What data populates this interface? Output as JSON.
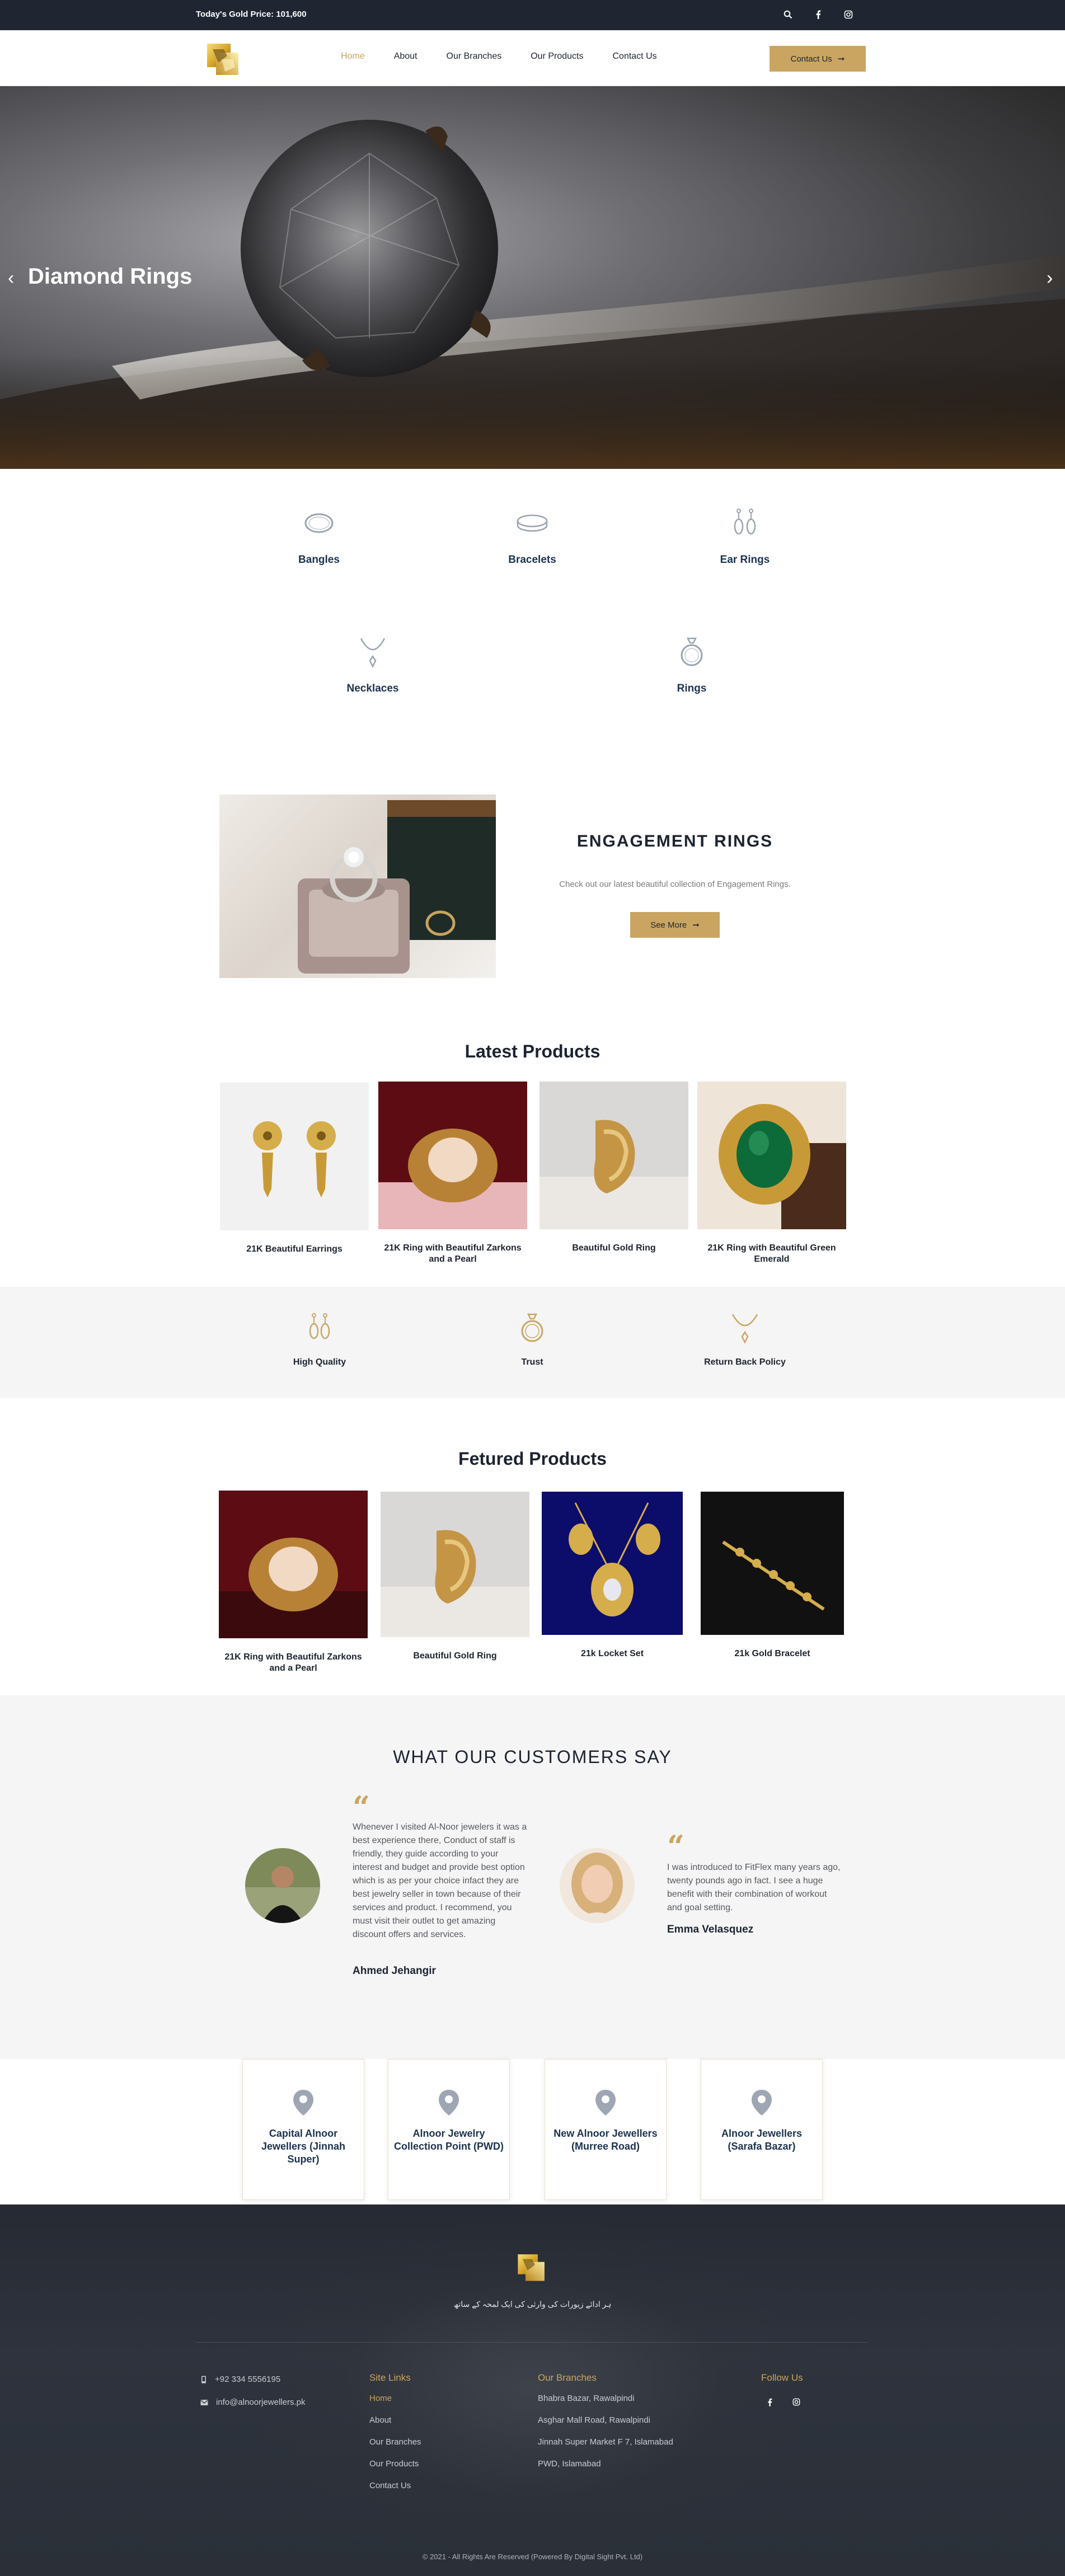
{
  "topbar": {
    "gold_price": "Today's Gold Price: 101,600",
    "icons": [
      "search-icon",
      "facebook-icon",
      "instagram-icon"
    ]
  },
  "nav": {
    "items": [
      {
        "label": "Home",
        "active": true
      },
      {
        "label": "About"
      },
      {
        "label": "Our Branches"
      },
      {
        "label": "Our Products"
      },
      {
        "label": "Contact Us"
      }
    ],
    "cta": "Contact Us"
  },
  "hero": {
    "title": "Diamond Rings",
    "prev_arrow": "‹",
    "next_arrow": "›"
  },
  "categories": [
    {
      "label": "Bangles",
      "icon": "bangle-icon"
    },
    {
      "label": "Bracelets",
      "icon": "bracelet-icon"
    },
    {
      "label": "Ear Rings",
      "icon": "earrings-icon"
    },
    {
      "label": "Necklaces",
      "icon": "necklace-icon"
    },
    {
      "label": "Rings",
      "icon": "ring-icon"
    }
  ],
  "engagement": {
    "title": "ENGAGEMENT RINGS",
    "subtitle": "Check out our latest beautiful collection of Engagement Rings.",
    "button": "See More"
  },
  "latest": {
    "heading": "Latest Products",
    "products": [
      {
        "name": "21K Beautiful Earrings"
      },
      {
        "name": "21K Ring with Beautiful Zarkons and a Pearl"
      },
      {
        "name": "Beautiful Gold Ring"
      },
      {
        "name": "21K Ring with Beautiful Green Emerald"
      }
    ]
  },
  "features": [
    {
      "label": "High Quality",
      "icon": "earrings-icon"
    },
    {
      "label": "Trust",
      "icon": "ring-icon"
    },
    {
      "label": "Return Back Policy",
      "icon": "necklace-icon"
    }
  ],
  "featured": {
    "heading": "Fetured Products",
    "products": [
      {
        "name": "21K Ring with Beautiful Zarkons and a Pearl"
      },
      {
        "name": "Beautiful Gold Ring"
      },
      {
        "name": "21k Locket Set"
      },
      {
        "name": "21k Gold Bracelet"
      }
    ]
  },
  "testimonials": {
    "heading": "WHAT OUR CUSTOMERS SAY",
    "items": [
      {
        "text": "Whenever I visited Al-Noor jewelers it was a best experience there, Conduct of staff is friendly, they guide according to your interest and budget and provide best option which is as per your choice infact they are best jewelry seller in town because of their services and product. I recommend, you must visit their outlet to get amazing discount offers and services.",
        "name": "Ahmed Jehangir"
      },
      {
        "text": "I was introduced to FitFlex many years ago, twenty pounds ago in fact. I see a huge benefit with their combination of workout and goal setting.",
        "name": "Emma Velasquez"
      }
    ]
  },
  "branches": [
    {
      "name": "Capital Alnoor Jewellers (Jinnah Super)"
    },
    {
      "name": "Alnoor Jewelry Collection Point (PWD)"
    },
    {
      "name": "New Alnoor Jewellers (Murree Road)"
    },
    {
      "name": "Alnoor Jewellers (Sarafa Bazar)"
    }
  ],
  "footer": {
    "tagline": "ہر ادائے زیورات کی وارثی کی ایک لمحہ کے ساتھ",
    "phone": "+92 334 5556195",
    "email": "info@alnoorjewellers.pk",
    "site_links_heading": "Site Links",
    "site_links": [
      "Home",
      "About",
      "Our Branches",
      "Our Products",
      "Contact Us"
    ],
    "branches_heading": "Our Branches",
    "branch_addresses": [
      "Bhabra Bazar, Rawalpindi",
      "Asghar Mall Road, Rawalpindi",
      "Jinnah Super Market F 7, Islamabad",
      "PWD, Islamabad"
    ],
    "follow_heading": "Follow Us",
    "copyright": "© 2021 - All Rights Are Reserved (Powered By Digital Sight Pvt. Ltd)"
  },
  "colors": {
    "accent": "#caa562",
    "dark": "#1f2632",
    "navy_text": "#1c3250"
  }
}
